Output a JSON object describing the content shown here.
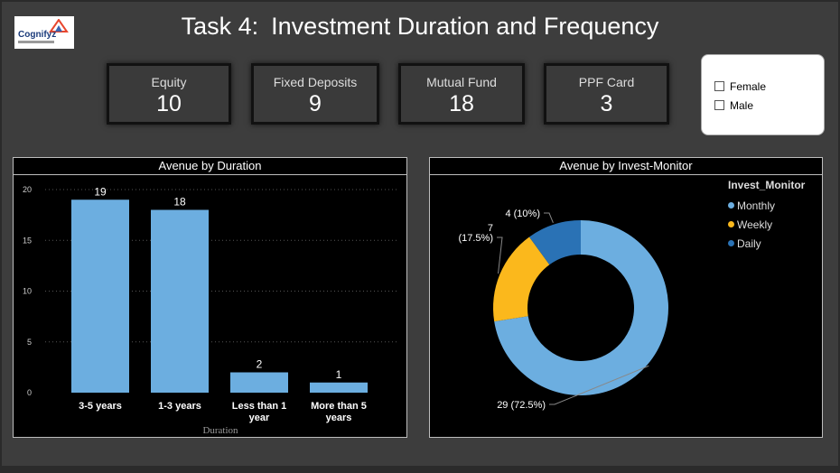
{
  "header": {
    "logo_text": "Cognifyz",
    "title_prefix": "Task 4:",
    "title": "Investment Duration and Frequency"
  },
  "kpis": [
    {
      "label": "Equity",
      "value": "10"
    },
    {
      "label": "Fixed Deposits",
      "value": "9"
    },
    {
      "label": "Mutual Fund",
      "value": "18"
    },
    {
      "label": "PPF Card",
      "value": "3"
    }
  ],
  "slicer": {
    "options": [
      {
        "label": "Female",
        "checked": false
      },
      {
        "label": "Male",
        "checked": false
      }
    ]
  },
  "panels": {
    "bar_title": "Avenue by Duration",
    "donut_title": "Avenue by Invest-Monitor"
  },
  "chart_data": [
    {
      "type": "bar",
      "title": "Avenue by Duration",
      "categories": [
        [
          "3-5 years"
        ],
        [
          "1-3 years"
        ],
        [
          "Less than 1",
          "year"
        ],
        [
          "More than 5",
          "years"
        ]
      ],
      "values": [
        19,
        18,
        2,
        1
      ],
      "xlabel": "Duration",
      "ylabel": "",
      "ylim": [
        0,
        20
      ],
      "yticks": [
        0,
        5,
        10,
        15,
        20
      ],
      "grid": true,
      "bar_color": "#6caee0"
    },
    {
      "type": "pie",
      "style": "donut",
      "title": "Avenue by Invest-Monitor",
      "legend_title": "Invest_Monitor",
      "legend_position": "top-right",
      "slices": [
        {
          "name": "Monthly",
          "value": 29,
          "label": [
            "29 (72.5%)"
          ],
          "color": "#6caee0"
        },
        {
          "name": "Weekly",
          "value": 7,
          "label": [
            "7",
            "(17.5%)"
          ],
          "color": "#fbb81c"
        },
        {
          "name": "Daily",
          "value": 4,
          "label": [
            "4 (10%)"
          ],
          "color": "#2a72b5"
        }
      ]
    }
  ]
}
